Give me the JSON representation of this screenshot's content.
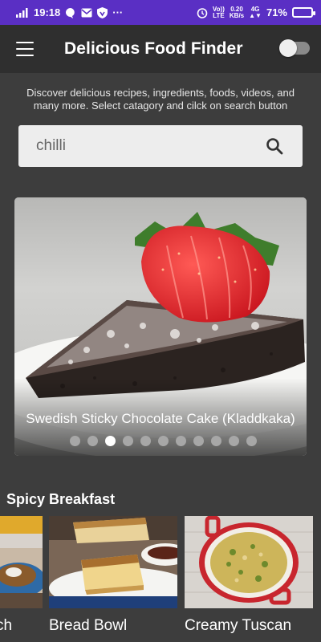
{
  "status_bar": {
    "signal": "4G",
    "time": "19:18",
    "notif_extra": "···",
    "volte_line1": "Vo))",
    "volte_line2": "LTE",
    "speed_line1": "0.20",
    "speed_line2": "KB/s",
    "network": "4G",
    "battery_percent": "71%",
    "battery_level": 0.71
  },
  "app_bar": {
    "title": "Delicious Food Finder",
    "toggle_on": false
  },
  "description": "Discover delicious recipes, ingredients, foods, videos, and many more. Select catagory and cilck on search button",
  "search": {
    "value": "chilli",
    "placeholder": ""
  },
  "carousel": {
    "caption": "Swedish Sticky Chocolate Cake (Kladdkaka)",
    "dot_count": 11,
    "active_index": 2
  },
  "section": {
    "title": "Spicy Breakfast",
    "cards": [
      {
        "title": "ch"
      },
      {
        "title": "Bread Bowl"
      },
      {
        "title": "Creamy Tuscan"
      }
    ]
  },
  "colors": {
    "status_bar": "#5a2fc4",
    "app_bar": "#2f2f2f",
    "background": "#3d3d3d"
  }
}
